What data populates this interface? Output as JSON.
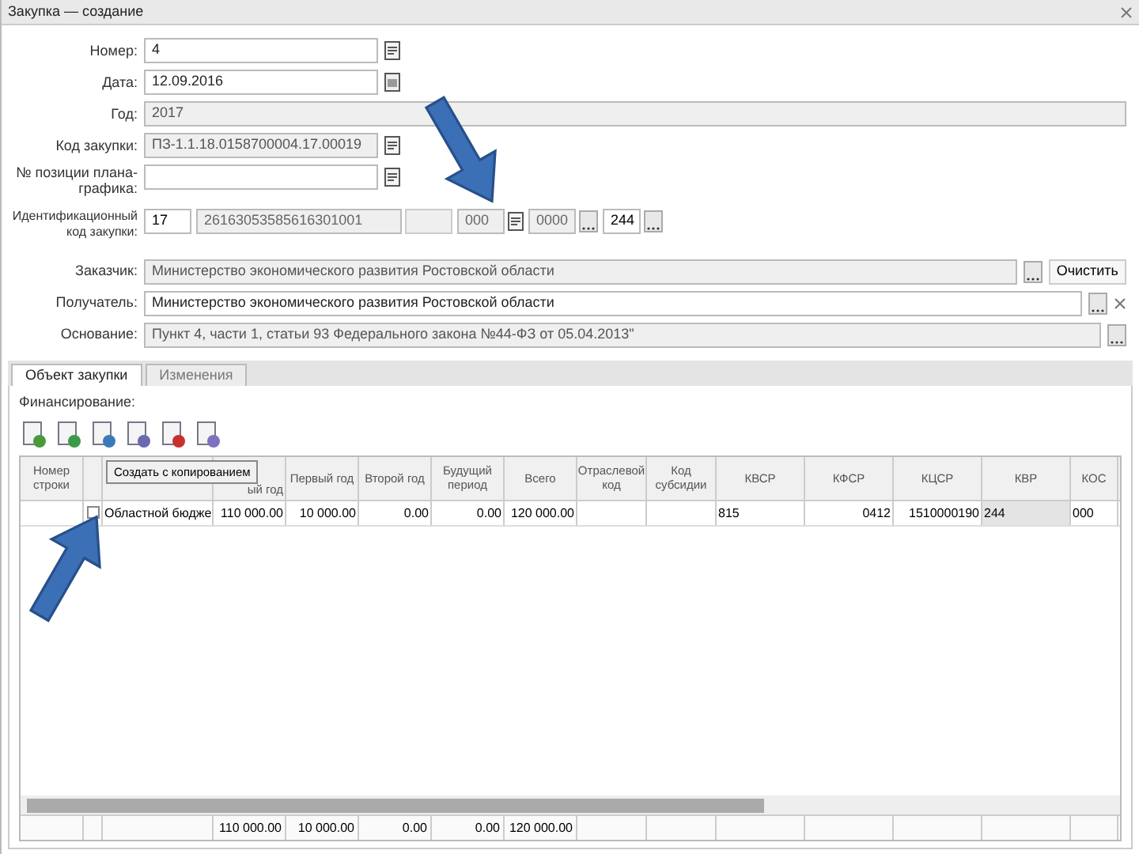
{
  "window": {
    "title": "Закупка — создание"
  },
  "fields": [
    {
      "label": "Номер:",
      "value": "4",
      "kind": "picker"
    },
    {
      "label": "Дата:",
      "value": "12.09.2016",
      "kind": "date"
    },
    {
      "label": "Год:",
      "value": "2017",
      "kind": "readonly_wide"
    },
    {
      "label": "Код закупки:",
      "value": "ПЗ-1.1.18.0158700004.17.00019",
      "kind": "readonly_picker"
    },
    {
      "label": "№ позиции плана-графика:",
      "kind": "picker"
    }
  ],
  "ikz": {
    "label": "Идентификационный код закупки:",
    "parts": [
      "17",
      "26163053585616301001",
      "000",
      "0000",
      "244"
    ]
  },
  "parties": [
    {
      "label": "Заказчик:",
      "value": "Министерство экономического развития Ростовской области",
      "kind": "readonly",
      "action": "Очистить"
    },
    {
      "label": "Получатель:",
      "value": "Министерство экономического развития Ростовской области",
      "kind": "editable_clear"
    },
    {
      "label": "Основание:",
      "value": "Пункт 4, части 1, статьи 93 Федерального закона №44-ФЗ от 05.04.2013\"",
      "kind": "readonly"
    }
  ],
  "tabs": [
    {
      "label": "Объект закупки",
      "selected": true
    },
    {
      "label": "Изменения",
      "selected": false
    }
  ],
  "section": "Финансирование:",
  "tooltip": "Создать с копированием",
  "table": {
    "columns": [
      "Номер строки",
      null,
      null,
      "ый год",
      "Первый год",
      "Второй год",
      "Будущий период",
      "Всего",
      "Отраслевой код",
      "Код субсидии",
      "КВСР",
      "КФСР",
      "КЦСР",
      "КВР",
      "КОС"
    ],
    "rows": [
      {
        "checked": false,
        "cells": [
          null,
          null,
          "Областной бюдже",
          "110 000.00",
          "10 000.00",
          "0.00",
          "0.00",
          "120 000.00",
          null,
          null,
          "815",
          "0412",
          "1510000190",
          "244",
          "000"
        ]
      }
    ],
    "totals": [
      "110 000.00",
      "10 000.00",
      "0.00",
      "0.00",
      "120 000.00"
    ]
  }
}
